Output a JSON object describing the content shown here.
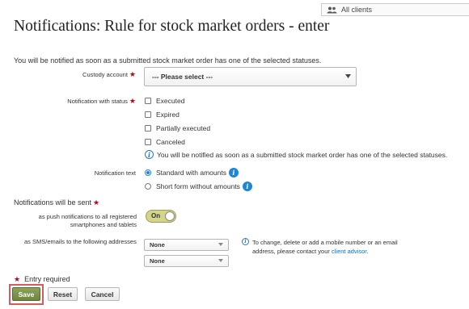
{
  "top_bar": {
    "client_filter_label": "All clients",
    "icon": "people-icon"
  },
  "page_title": "Notifications: Rule for stock market orders - enter",
  "intro_text": "You will be notified as soon as a submitted stock market order has one of the selected statuses.",
  "custody_account": {
    "label": "Custody account",
    "selected": "--- Please select ---"
  },
  "notification_status": {
    "label": "Notification with status",
    "options": [
      "Executed",
      "Expired",
      "Partially executed",
      "Canceled"
    ],
    "hint": "You will be notified as soon as a submitted stock market order has one of the selected statuses."
  },
  "notification_text": {
    "label": "Notification text",
    "options": [
      "Standard with amounts",
      "Short form without amounts"
    ],
    "selected": "Standard with amounts"
  },
  "sent_section": {
    "title": "Notifications will be sent",
    "push_label_line1": "as push notifications to all registered",
    "push_label_line2": "smartphones and tablets",
    "push_toggle": "On",
    "sms_label": "as SMS/emails to the following addresses",
    "sms_select_1": "None",
    "sms_select_2": "None",
    "info_text": "To change, delete or add a mobile number or an email address, please contact your ",
    "info_link": "client advisor",
    "info_end": "."
  },
  "entry_required": "Entry required",
  "buttons": {
    "save": "Save",
    "reset": "Reset",
    "cancel": "Cancel"
  },
  "colors": {
    "accent_blue": "#1d86d6",
    "required_red": "#c0001a",
    "save_green": "#7a8f48",
    "highlight_red": "#d85a5a"
  }
}
